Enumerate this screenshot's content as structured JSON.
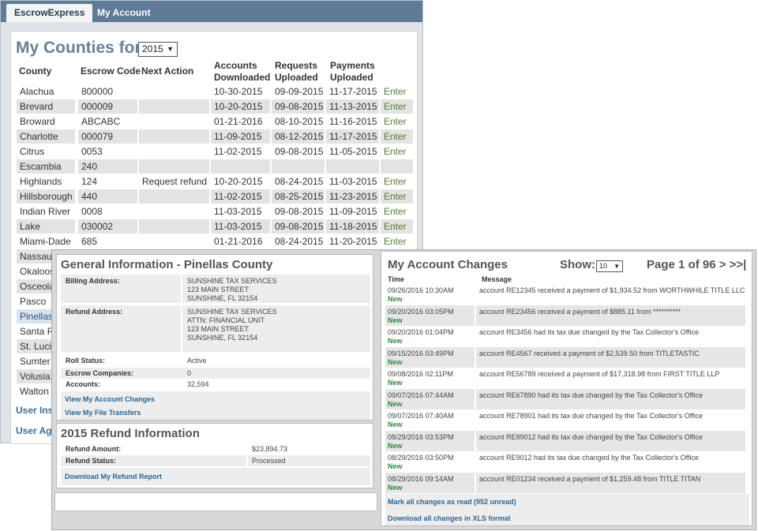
{
  "app": {
    "tabs": [
      {
        "label": "EscrowExpress",
        "active": true
      },
      {
        "label": "My Account",
        "active": false
      }
    ]
  },
  "counties": {
    "title": "My Counties for",
    "year": "2015",
    "headers": {
      "county": "County",
      "code": "Escrow Code",
      "action": "Next Action",
      "accounts": [
        "Accounts",
        "Downloaded"
      ],
      "requests": [
        "Requests",
        "Uploaded"
      ],
      "payments": [
        "Payments",
        "Uploaded"
      ]
    },
    "rows": [
      {
        "county": "Alachua",
        "code": "800000",
        "action": "",
        "acct": "10-30-2015",
        "req": "09-09-2015",
        "pay": "11-17-2015",
        "enter": "Enter"
      },
      {
        "county": "Brevard",
        "code": "000009",
        "action": "",
        "acct": "10-20-2015",
        "req": "09-08-2015",
        "pay": "11-13-2015",
        "enter": "Enter"
      },
      {
        "county": "Broward",
        "code": "ABCABC",
        "action": "",
        "acct": "01-21-2016",
        "req": "08-10-2015",
        "pay": "11-16-2015",
        "enter": "Enter"
      },
      {
        "county": "Charlotte",
        "code": "000079",
        "action": "",
        "acct": "11-09-2015",
        "req": "08-12-2015",
        "pay": "11-17-2015",
        "enter": "Enter"
      },
      {
        "county": "Citrus",
        "code": "0053",
        "action": "",
        "acct": "11-02-2015",
        "req": "09-08-2015",
        "pay": "11-05-2015",
        "enter": "Enter"
      },
      {
        "county": "Escambia",
        "code": "240",
        "action": "",
        "acct": "",
        "req": "",
        "pay": "",
        "enter": ""
      },
      {
        "county": "Highlands",
        "code": "124",
        "action": "Request refund",
        "acct": "10-20-2015",
        "req": "08-24-2015",
        "pay": "11-03-2015",
        "enter": "Enter"
      },
      {
        "county": "Hillsborough",
        "code": "440",
        "action": "",
        "acct": "11-02-2015",
        "req": "08-25-2015",
        "pay": "11-23-2015",
        "enter": "Enter"
      },
      {
        "county": "Indian River",
        "code": "0008",
        "action": "",
        "acct": "11-03-2015",
        "req": "09-08-2015",
        "pay": "11-09-2015",
        "enter": "Enter"
      },
      {
        "county": "Lake",
        "code": "030002",
        "action": "",
        "acct": "11-03-2015",
        "req": "09-08-2015",
        "pay": "11-18-2015",
        "enter": "Enter"
      },
      {
        "county": "Miami-Dade",
        "code": "685",
        "action": "",
        "acct": "01-21-2016",
        "req": "08-24-2015",
        "pay": "11-20-2015",
        "enter": "Enter"
      },
      {
        "county": "Nassau",
        "code": "",
        "action": "",
        "acct": "",
        "req": "",
        "pay": "",
        "enter": ""
      },
      {
        "county": "Okaloos",
        "code": "",
        "action": "",
        "acct": "",
        "req": "",
        "pay": "",
        "enter": ""
      },
      {
        "county": "Osceola",
        "code": "",
        "action": "",
        "acct": "",
        "req": "",
        "pay": "",
        "enter": ""
      },
      {
        "county": "Pasco",
        "code": "",
        "action": "",
        "acct": "",
        "req": "",
        "pay": "",
        "enter": ""
      },
      {
        "county": "Pinellas",
        "code": "",
        "action": "",
        "acct": "",
        "req": "",
        "pay": "",
        "enter": "",
        "selected": true
      },
      {
        "county": "Santa Ro",
        "code": "",
        "action": "",
        "acct": "",
        "req": "",
        "pay": "",
        "enter": ""
      },
      {
        "county": "St. Lucie",
        "code": "",
        "action": "",
        "acct": "",
        "req": "",
        "pay": "",
        "enter": ""
      },
      {
        "county": "Sumter",
        "code": "",
        "action": "",
        "acct": "",
        "req": "",
        "pay": "",
        "enter": ""
      },
      {
        "county": "Volusia",
        "code": "",
        "action": "",
        "acct": "",
        "req": "",
        "pay": "",
        "enter": ""
      },
      {
        "county": "Walton",
        "code": "",
        "action": "",
        "acct": "",
        "req": "",
        "pay": "",
        "enter": ""
      }
    ],
    "links": [
      "User Inst",
      "User Agr"
    ]
  },
  "general": {
    "title": "General Information - Pinellas County",
    "billing_label": "Billing Address:",
    "billing_lines": [
      "SUNSHINE TAX SERVICES",
      "123 MAIN STREET",
      "SUNSHINE, FL 32154"
    ],
    "refund_label": "Refund Address:",
    "refund_lines": [
      "SUNSHINE TAX SERVICES",
      "ATTN: FINANCIAL UNIT",
      "123 MAIN STREET",
      "SUNSHINE, FL 32154"
    ],
    "roll_label": "Roll Status:",
    "roll_value": "Active",
    "escrow_label": "Escrow Companies:",
    "escrow_value": "0",
    "accounts_label": "Accounts:",
    "accounts_value": "32,594",
    "link_changes": "View My Account Changes",
    "link_transfers": "View My File Transfers"
  },
  "refund": {
    "title": "2015 Refund Information",
    "amount_label": "Refund Amount:",
    "amount_value": "$23,894.73",
    "status_label": "Refund Status:",
    "status_value": "Processed",
    "link_report": "Download My Refund Report"
  },
  "changes": {
    "title": "My Account Changes",
    "show_label": "Show:",
    "show_value": "10",
    "page_label": "Page 1 of 96 > >>|",
    "col_time": "Time",
    "col_message": "Message",
    "rows": [
      {
        "time": "09/26/2016 10:30AM",
        "badge": "New",
        "message": "account RE12345 received a payment of $1,934.52 from WORTHWHILE TITLE LLC"
      },
      {
        "time": "09/20/2016 03:05PM",
        "badge": "New",
        "message": "account RE23456 received a payment of $885.11 from **********"
      },
      {
        "time": "09/20/2016 01:04PM",
        "badge": "New",
        "message": "account RE3456 had its tax due changed by the Tax Collector's Office"
      },
      {
        "time": "09/15/2016 03:49PM",
        "badge": "New",
        "message": "account RE4567 received a payment of $2,539.50 from TITLETASTIC"
      },
      {
        "time": "09/08/2016 02:11PM",
        "badge": "New",
        "message": "account RE56789 received a payment of $17,318.98 from FIRST TITLE LLP"
      },
      {
        "time": "09/07/2016 07:44AM",
        "badge": "New",
        "message": "account RE67890 had its tax due changed by the Tax Collector's Office"
      },
      {
        "time": "09/07/2016 07:40AM",
        "badge": "New",
        "message": "account RE78901 had its tax due changed by the Tax Collector's Office"
      },
      {
        "time": "08/29/2016 03:53PM",
        "badge": "New",
        "message": "account RE89012 had its tax due changed by the Tax Collector's Office"
      },
      {
        "time": "08/29/2016 03:50PM",
        "badge": "New",
        "message": "account RE9012 had its tax due changed by the Tax Collector's Office"
      },
      {
        "time": "08/29/2016 09:14AM",
        "badge": "New",
        "message": "account RE01234 received a payment of $1,259.48 from TITLE TITAN"
      }
    ],
    "link_mark_read": "Mark all changes as read (952 unread)",
    "link_download": "Download all changes in XLS format"
  }
}
